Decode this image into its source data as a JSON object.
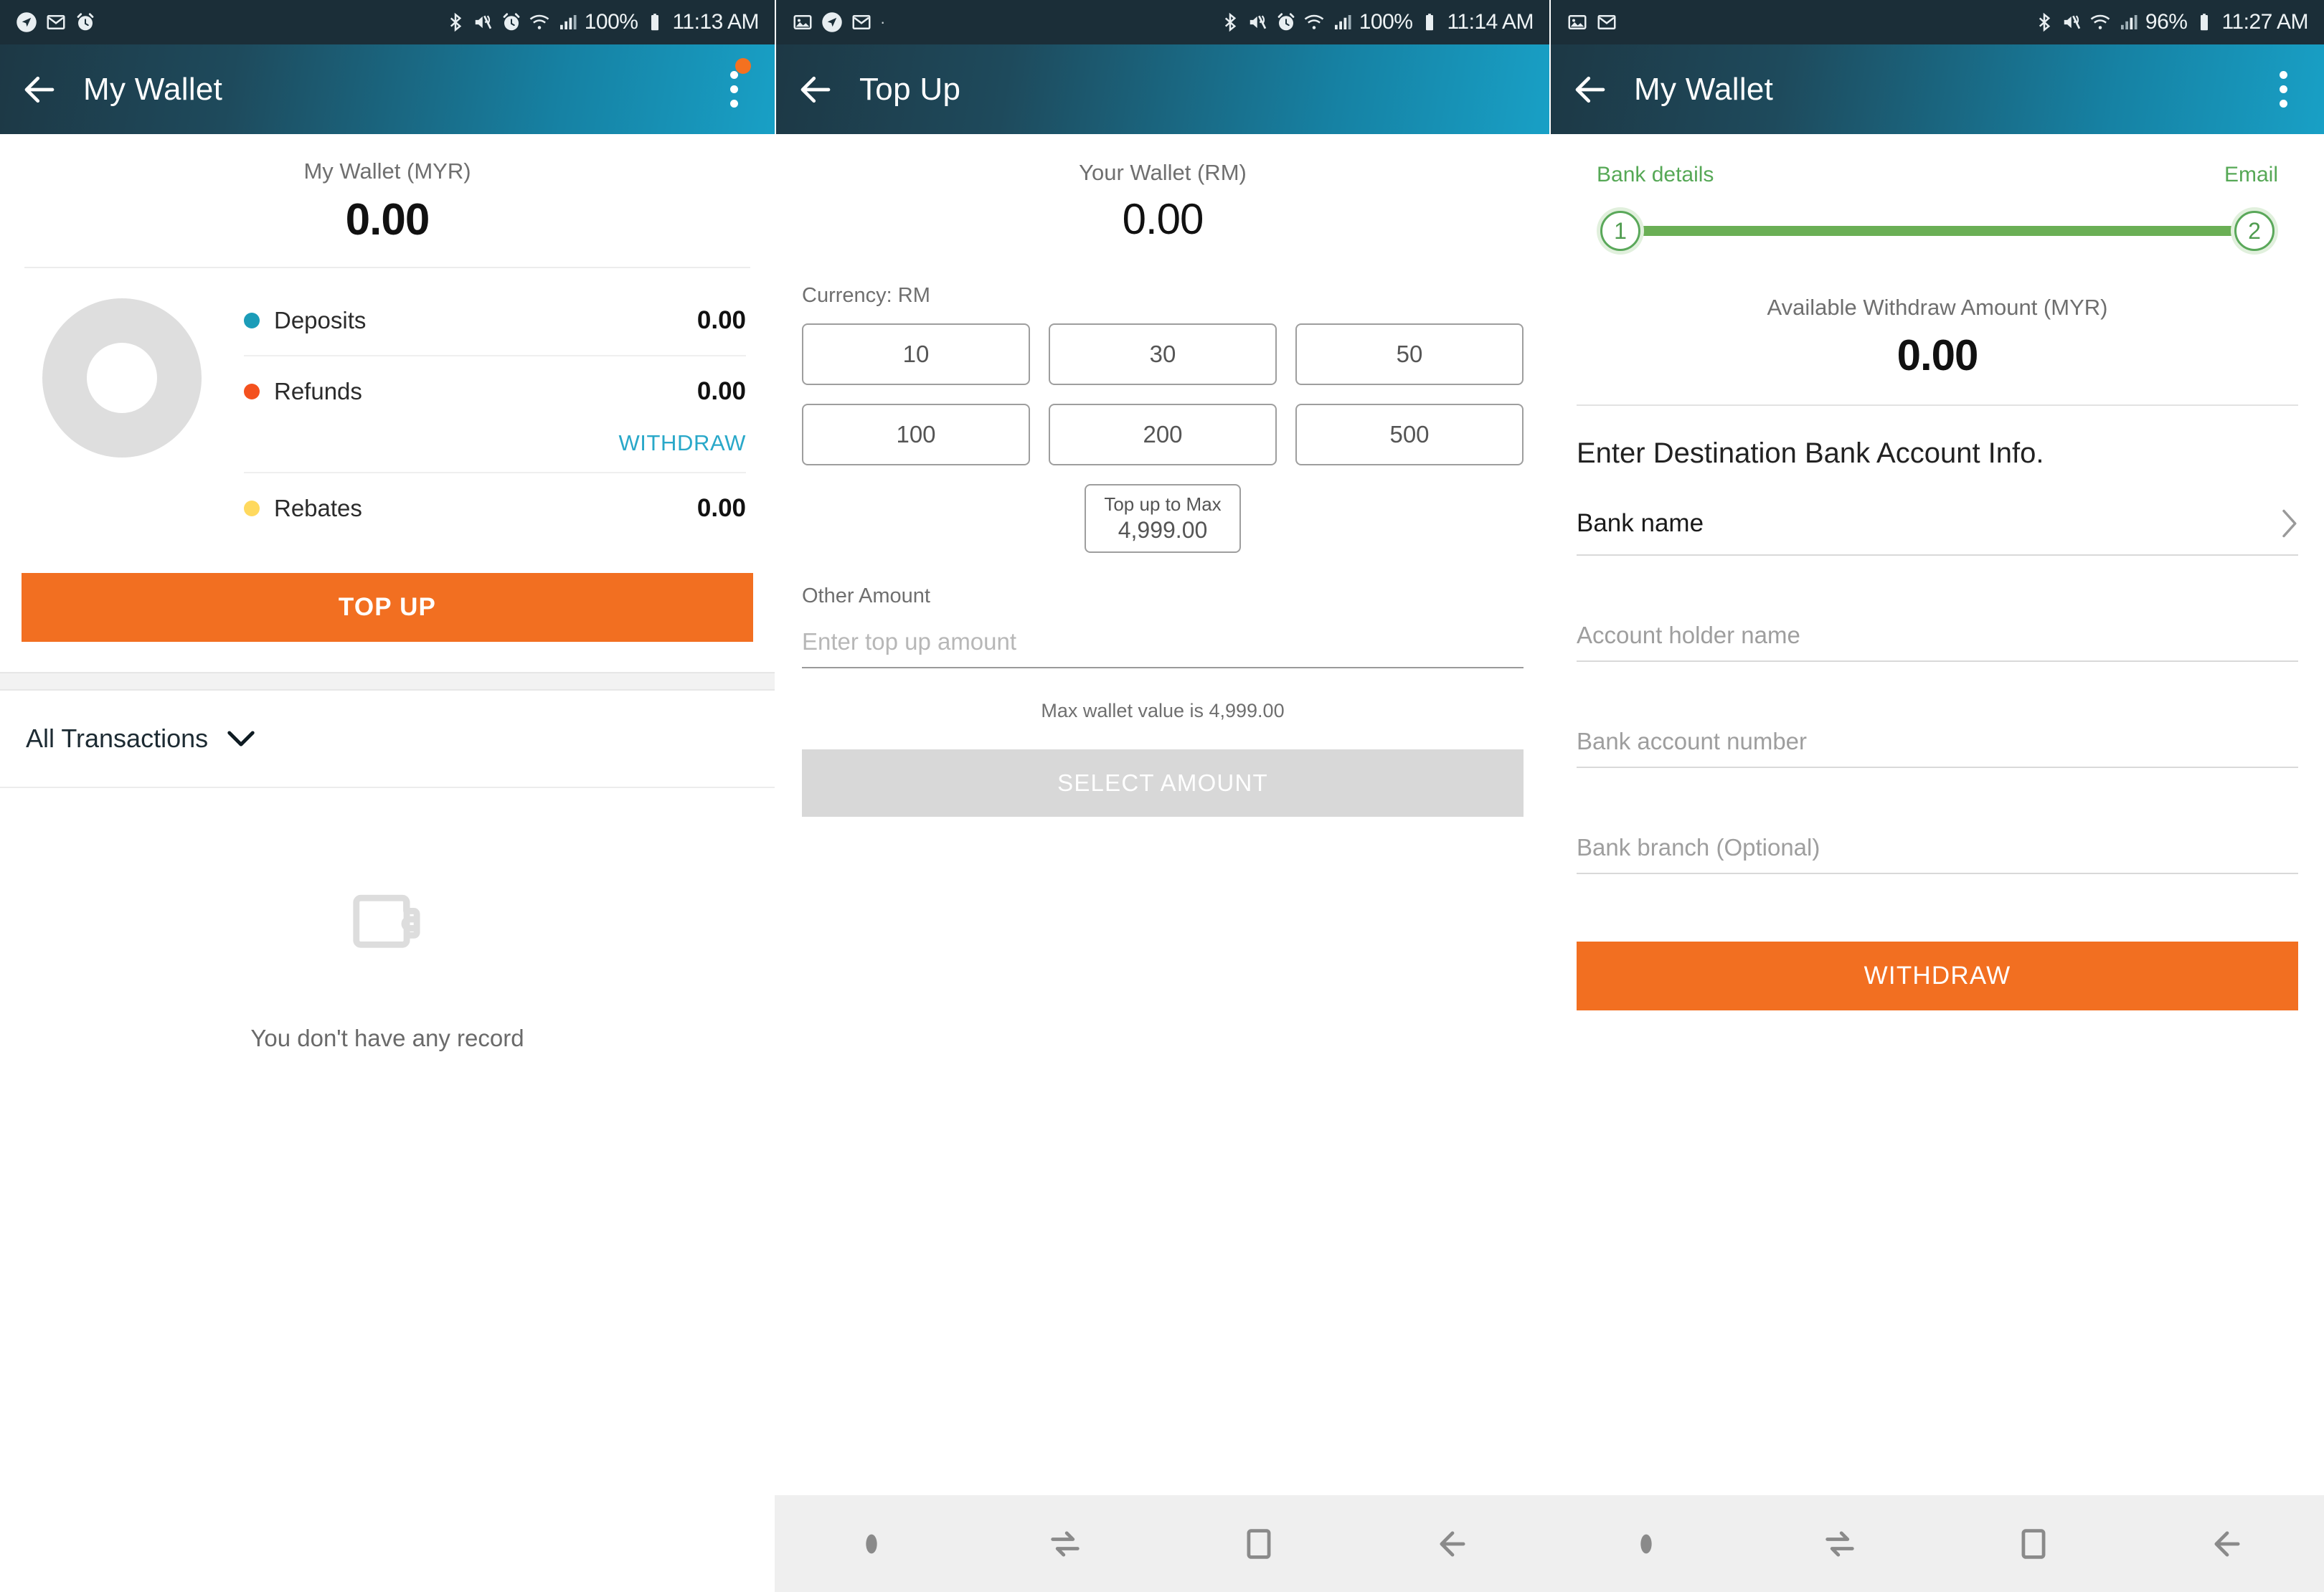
{
  "panels": [
    {
      "status_bar": {
        "left_icons": [
          "navigation-icon",
          "gmail-icon",
          "alarm-icon"
        ],
        "right_icons": [
          "bluetooth-icon",
          "mute-vibrate-icon",
          "alarm-icon",
          "wifi-icon",
          "signal-icon"
        ],
        "battery_percent": "100%",
        "time": "11:13 AM"
      },
      "app_bar": {
        "title": "My Wallet",
        "has_badge": true
      },
      "wallet": {
        "label": "My Wallet (MYR)",
        "amount": "0.00",
        "rows": [
          {
            "name": "Deposits",
            "value": "0.00",
            "color": "#1b9cb8"
          },
          {
            "name": "Refunds",
            "value": "0.00",
            "color": "#f4511e"
          },
          {
            "name": "Rebates",
            "value": "0.00",
            "color": "#ffd95e"
          }
        ],
        "withdraw_link": "WITHDRAW",
        "top_up_label": "TOP UP"
      },
      "transactions": {
        "filter_label": "All Transactions",
        "empty_text": "You don't have any record"
      }
    },
    {
      "status_bar": {
        "left_icons": [
          "image-icon",
          "navigation-icon",
          "gmail-icon",
          "dot-icon"
        ],
        "right_icons": [
          "bluetooth-icon",
          "mute-vibrate-icon",
          "alarm-icon",
          "wifi-icon",
          "signal-icon"
        ],
        "battery_percent": "100%",
        "time": "11:14 AM"
      },
      "app_bar": {
        "title": "Top Up",
        "has_badge": false
      },
      "topup": {
        "wallet_label": "Your Wallet (RM)",
        "wallet_amount": "0.00",
        "currency_label": "Currency: RM",
        "amounts": [
          "10",
          "30",
          "50",
          "100",
          "200",
          "500"
        ],
        "max_chip_title": "Top up to Max",
        "max_chip_value": "4,999.00",
        "other_amount_label": "Other Amount",
        "other_amount_placeholder": "Enter top up amount",
        "max_note": "Max wallet value is 4,999.00",
        "submit_label": "SELECT AMOUNT"
      }
    },
    {
      "status_bar": {
        "left_icons": [
          "image-icon",
          "gmail-icon"
        ],
        "right_icons": [
          "bluetooth-icon",
          "mute-vibrate-icon",
          "wifi-icon",
          "signal-icon"
        ],
        "battery_percent": "96%",
        "time": "11:27 AM"
      },
      "app_bar": {
        "title": "My Wallet",
        "has_badge": false
      },
      "withdraw": {
        "steps": [
          {
            "number": "1",
            "label": "Bank details"
          },
          {
            "number": "2",
            "label": "Email"
          }
        ],
        "available_label": "Available Withdraw Amount (MYR)",
        "available_amount": "0.00",
        "section_heading": "Enter Destination Bank Account Info.",
        "bank_name_label": "Bank name",
        "fields": [
          {
            "placeholder": "Account holder name"
          },
          {
            "placeholder": "Bank account number"
          },
          {
            "placeholder": "Bank branch (Optional)"
          }
        ],
        "submit_label": "WITHDRAW"
      }
    }
  ],
  "nav_bar": {
    "buttons": [
      "menu-dot-icon",
      "recents-icon",
      "home-icon",
      "back-icon"
    ]
  },
  "colors": {
    "accent_orange": "#f26f21",
    "header_dark": "#1d3845",
    "header_teal": "#18a0c6",
    "link_blue": "#29a8c9",
    "step_green": "#5aa85a"
  }
}
